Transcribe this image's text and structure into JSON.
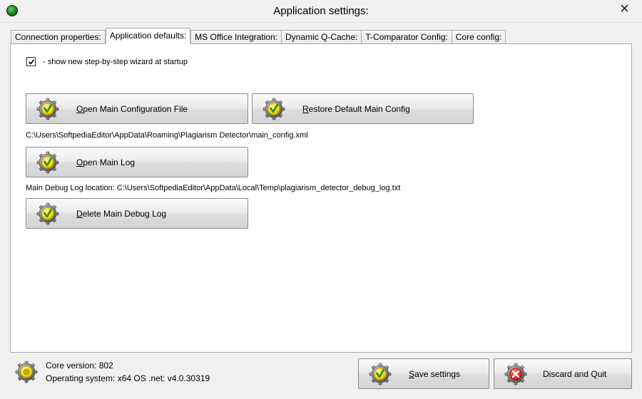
{
  "window": {
    "title": "Application settings:",
    "close_icon": "close-icon"
  },
  "tabs": [
    {
      "label": "Connection properties:"
    },
    {
      "label": "Application defaults:"
    },
    {
      "label": "MS Office Integration:"
    },
    {
      "label": "Dynamic Q-Cache:"
    },
    {
      "label": "T-Comparator Config:"
    },
    {
      "label": "Core config:"
    }
  ],
  "active_tab": "Application defaults:",
  "wizard": {
    "checked": true,
    "label": "- show new step-by-step wizard at startup"
  },
  "buttons": {
    "open_main_config": "Open Main Configuration File",
    "restore_default": "Restore Default Main Config",
    "open_main_log": "Open Main Log",
    "delete_debug_log": "Delete Main Debug Log",
    "save_settings": "Save settings",
    "discard_quit": "Discard and Quit"
  },
  "paths": {
    "main_config": "C:\\Users\\SoftpediaEditor\\AppData\\Roaming\\Plagiarism Detector\\main_config.xml",
    "debug_log": "Main Debug Log location: C:\\Users\\SoftpediaEditor\\AppData\\Local\\Temp\\plagiarism_detector_debug_log.txt"
  },
  "status": {
    "core_version": "Core version: 802",
    "os": "Operating system: x64 OS .net: v4.0.30319"
  },
  "colors": {
    "gear": "#8a8a8a",
    "check_badge": "#f2d600",
    "check_mark": "#2e8b1e",
    "cross_badge": "#e0261b"
  }
}
